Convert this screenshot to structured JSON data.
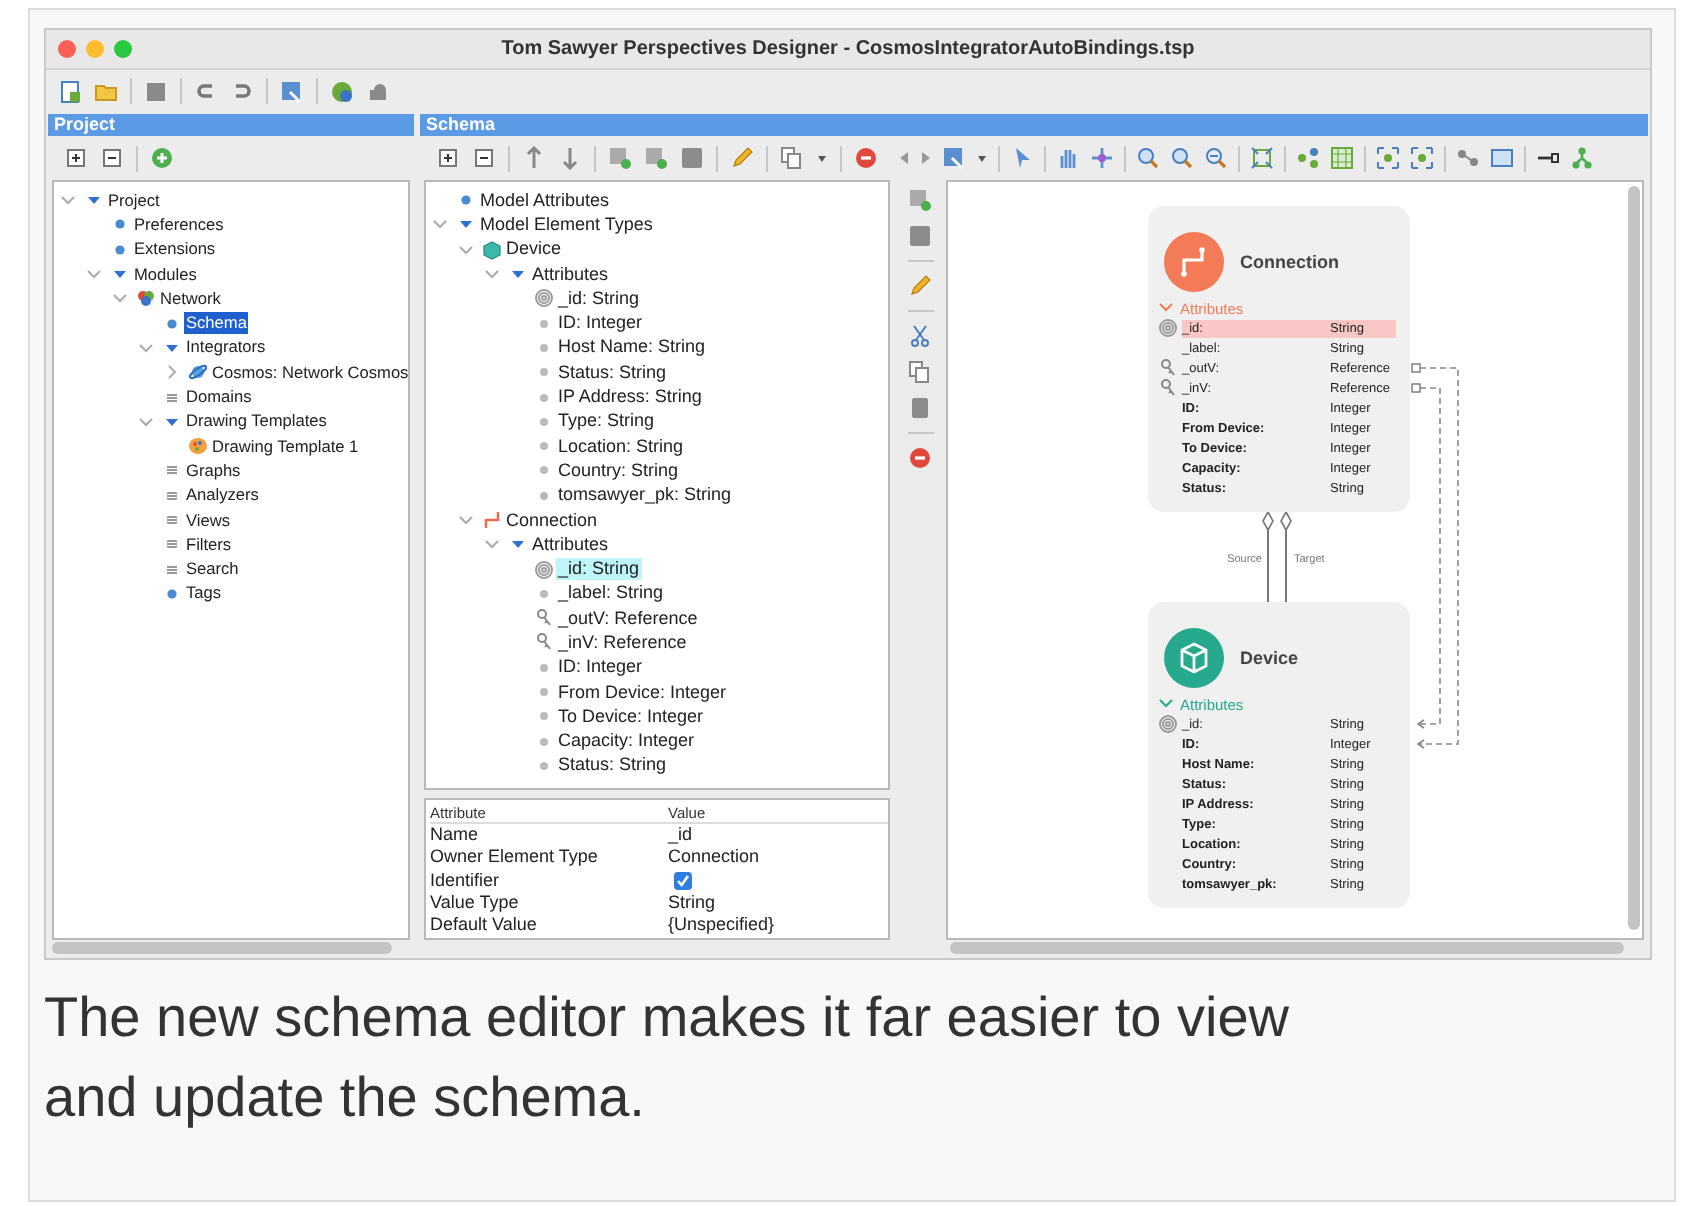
{
  "window": {
    "title": "Tom Sawyer Perspectives Designer - CosmosIntegratorAutoBindings.tsp"
  },
  "project": {
    "title": "Project",
    "tree": [
      {
        "label": "Project",
        "kind": "group",
        "expanded": true,
        "selected": false,
        "children": [
          {
            "label": "Preferences",
            "kind": "item",
            "selected": false
          },
          {
            "label": "Extensions",
            "kind": "item",
            "selected": false
          },
          {
            "label": "Modules",
            "kind": "group",
            "expanded": true,
            "selected": false,
            "children": [
              {
                "label": "Network",
                "kind": "module",
                "expanded": true,
                "selected": false,
                "children": [
                  {
                    "label": "Schema",
                    "kind": "item",
                    "selected": true
                  },
                  {
                    "label": "Integrators",
                    "kind": "group",
                    "expanded": true,
                    "selected": false,
                    "children": [
                      {
                        "label": "Cosmos: Network Cosmos",
                        "kind": "integrator",
                        "expanded": false,
                        "selected": false
                      }
                    ]
                  },
                  {
                    "label": "Domains",
                    "kind": "list",
                    "selected": false
                  },
                  {
                    "label": "Drawing Templates",
                    "kind": "group",
                    "expanded": true,
                    "selected": false,
                    "children": [
                      {
                        "label": "Drawing Template 1",
                        "kind": "template",
                        "selected": false
                      }
                    ]
                  },
                  {
                    "label": "Graphs",
                    "kind": "list",
                    "selected": false
                  },
                  {
                    "label": "Analyzers",
                    "kind": "list",
                    "selected": false
                  },
                  {
                    "label": "Views",
                    "kind": "list",
                    "selected": false
                  },
                  {
                    "label": "Filters",
                    "kind": "list",
                    "selected": false
                  },
                  {
                    "label": "Search",
                    "kind": "list",
                    "selected": false
                  },
                  {
                    "label": "Tags",
                    "kind": "item",
                    "selected": false
                  }
                ]
              }
            ]
          }
        ]
      }
    ]
  },
  "schema": {
    "title": "Schema",
    "tree": [
      {
        "label": "Model Attributes",
        "kind": "item",
        "selected": false
      },
      {
        "label": "Model Element Types",
        "kind": "group",
        "expanded": true,
        "selected": false,
        "children": [
          {
            "label": "Device",
            "kind": "entity",
            "expanded": true,
            "selected": false,
            "children": [
              {
                "label": "Attributes",
                "kind": "group",
                "expanded": true,
                "selected": false,
                "children": [
                  {
                    "label": "_id: String",
                    "kind": "id",
                    "selected": false
                  },
                  {
                    "label": "ID: Integer",
                    "kind": "attribute",
                    "selected": false
                  },
                  {
                    "label": "Host Name: String",
                    "kind": "attribute",
                    "selected": false
                  },
                  {
                    "label": "Status: String",
                    "kind": "attribute",
                    "selected": false
                  },
                  {
                    "label": "IP Address: String",
                    "kind": "attribute",
                    "selected": false
                  },
                  {
                    "label": "Type: String",
                    "kind": "attribute",
                    "selected": false
                  },
                  {
                    "label": "Location: String",
                    "kind": "attribute",
                    "selected": false
                  },
                  {
                    "label": "Country: String",
                    "kind": "attribute",
                    "selected": false
                  },
                  {
                    "label": "tomsawyer_pk: String",
                    "kind": "attribute",
                    "selected": false
                  }
                ]
              }
            ]
          },
          {
            "label": "Connection",
            "kind": "relation",
            "expanded": true,
            "selected": false,
            "children": [
              {
                "label": "Attributes",
                "kind": "group",
                "expanded": true,
                "selected": false,
                "children": [
                  {
                    "label": "_id: String",
                    "kind": "id",
                    "selected": true
                  },
                  {
                    "label": "_label: String",
                    "kind": "attribute",
                    "selected": false
                  },
                  {
                    "label": "_outV: Reference",
                    "kind": "reference",
                    "selected": false
                  },
                  {
                    "label": "_inV: Reference",
                    "kind": "reference",
                    "selected": false
                  },
                  {
                    "label": "ID: Integer",
                    "kind": "attribute",
                    "selected": false
                  },
                  {
                    "label": "From Device: Integer",
                    "kind": "attribute",
                    "selected": false
                  },
                  {
                    "label": "To Device: Integer",
                    "kind": "attribute",
                    "selected": false
                  },
                  {
                    "label": "Capacity: Integer",
                    "kind": "attribute",
                    "selected": false
                  },
                  {
                    "label": "Status: String",
                    "kind": "attribute",
                    "selected": false
                  }
                ]
              }
            ]
          }
        ]
      }
    ]
  },
  "properties": {
    "columns": [
      "Attribute",
      "Value"
    ],
    "rows": [
      {
        "attribute": "Name",
        "kind": "text",
        "value": "_id"
      },
      {
        "attribute": "Owner Element Type",
        "kind": "text",
        "value": "Connection"
      },
      {
        "attribute": "Identifier",
        "kind": "checkbox",
        "checked": true
      },
      {
        "attribute": "Value Type",
        "kind": "text",
        "value": "String"
      },
      {
        "attribute": "Default Value",
        "kind": "text",
        "value": "{Unspecified}"
      }
    ]
  },
  "diagram": {
    "nodes": [
      {
        "title": "Connection",
        "kind": "relation",
        "color": "#f47b57",
        "section": "Attributes",
        "attributes": [
          {
            "name": "_id:",
            "type": "String",
            "kind": "id",
            "selected": true
          },
          {
            "name": "_label:",
            "type": "String",
            "kind": "system",
            "selected": false
          },
          {
            "name": "_outV:",
            "type": "Reference",
            "kind": "reference",
            "selected": false
          },
          {
            "name": "_inV:",
            "type": "Reference",
            "kind": "reference",
            "selected": false
          },
          {
            "name": "ID:",
            "type": "Integer",
            "kind": "custom",
            "selected": false
          },
          {
            "name": "From Device:",
            "type": "Integer",
            "kind": "custom",
            "selected": false
          },
          {
            "name": "To Device:",
            "type": "Integer",
            "kind": "custom",
            "selected": false
          },
          {
            "name": "Capacity:",
            "type": "Integer",
            "kind": "custom",
            "selected": false
          },
          {
            "name": "Status:",
            "type": "String",
            "kind": "custom",
            "selected": false
          }
        ]
      },
      {
        "title": "Device",
        "kind": "entity",
        "color": "#26a98c",
        "section": "Attributes",
        "attributes": [
          {
            "name": "_id:",
            "type": "String",
            "kind": "id",
            "selected": false
          },
          {
            "name": "ID:",
            "type": "Integer",
            "kind": "custom",
            "selected": false
          },
          {
            "name": "Host Name:",
            "type": "String",
            "kind": "custom",
            "selected": false
          },
          {
            "name": "Status:",
            "type": "String",
            "kind": "custom",
            "selected": false
          },
          {
            "name": "IP Address:",
            "type": "String",
            "kind": "custom",
            "selected": false
          },
          {
            "name": "Type:",
            "type": "String",
            "kind": "custom",
            "selected": false
          },
          {
            "name": "Location:",
            "type": "String",
            "kind": "custom",
            "selected": false
          },
          {
            "name": "Country:",
            "type": "String",
            "kind": "custom",
            "selected": false
          },
          {
            "name": "tomsawyer_pk:",
            "type": "String",
            "kind": "custom",
            "selected": false
          }
        ]
      }
    ],
    "edges": [
      {
        "label": "Source"
      },
      {
        "label": "Target"
      }
    ]
  },
  "caption": "The new schema editor makes it far easier to view and update the schema."
}
